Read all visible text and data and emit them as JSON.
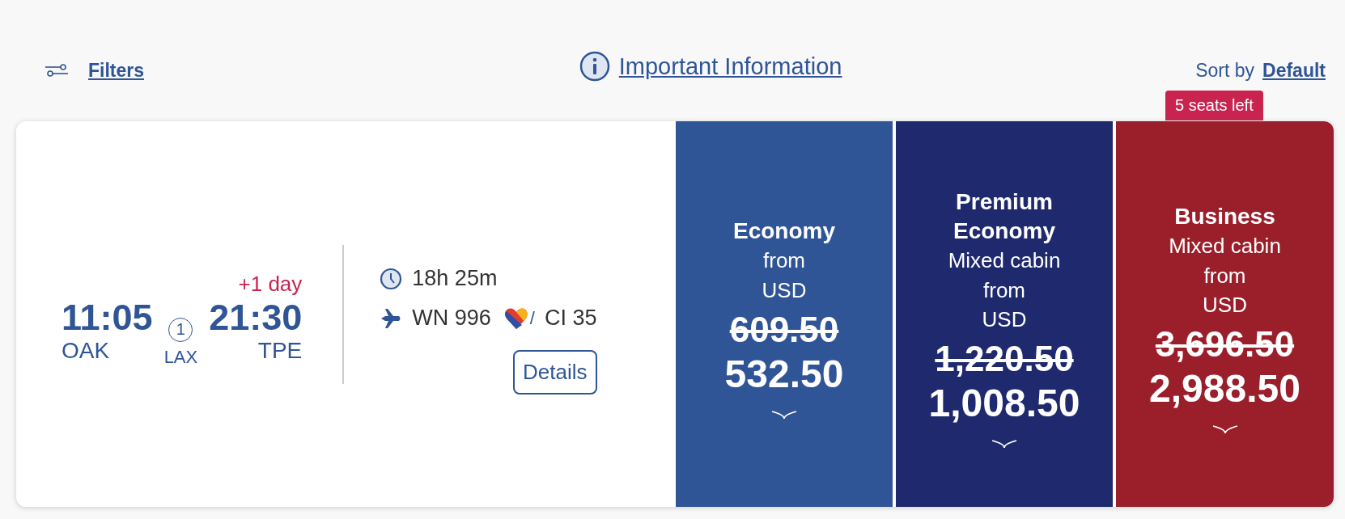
{
  "toolbar": {
    "filters": "Filters",
    "info": "Important Information",
    "sort_label": "Sort by",
    "sort_value": "Default"
  },
  "flight": {
    "arrive_day": "+1 day",
    "depart_time": "11:05",
    "depart_airport": "OAK",
    "stops": "1",
    "stop_airport": "LAX",
    "arrive_time": "21:30",
    "arrive_airport": "TPE",
    "duration": "18h 25m",
    "flight_primary": "WN 996",
    "separator": "/",
    "flight_secondary": "CI 35",
    "details": "Details"
  },
  "fares": [
    {
      "cabin": "Economy",
      "from": "from",
      "currency": "USD",
      "old_price": "609.50",
      "price": "532.50",
      "color": "#2f5597"
    },
    {
      "cabin": "Premium Economy",
      "note": "Mixed cabin",
      "from": "from",
      "currency": "USD",
      "old_price": "1,220.50",
      "price": "1,008.50",
      "color": "#1f2a6e"
    },
    {
      "cabin": "Business",
      "note": "Mixed cabin",
      "from": "from",
      "currency": "USD",
      "old_price": "3,696.50",
      "price": "2,988.50",
      "color": "#9b1f2b",
      "badge": "5 seats left"
    }
  ]
}
